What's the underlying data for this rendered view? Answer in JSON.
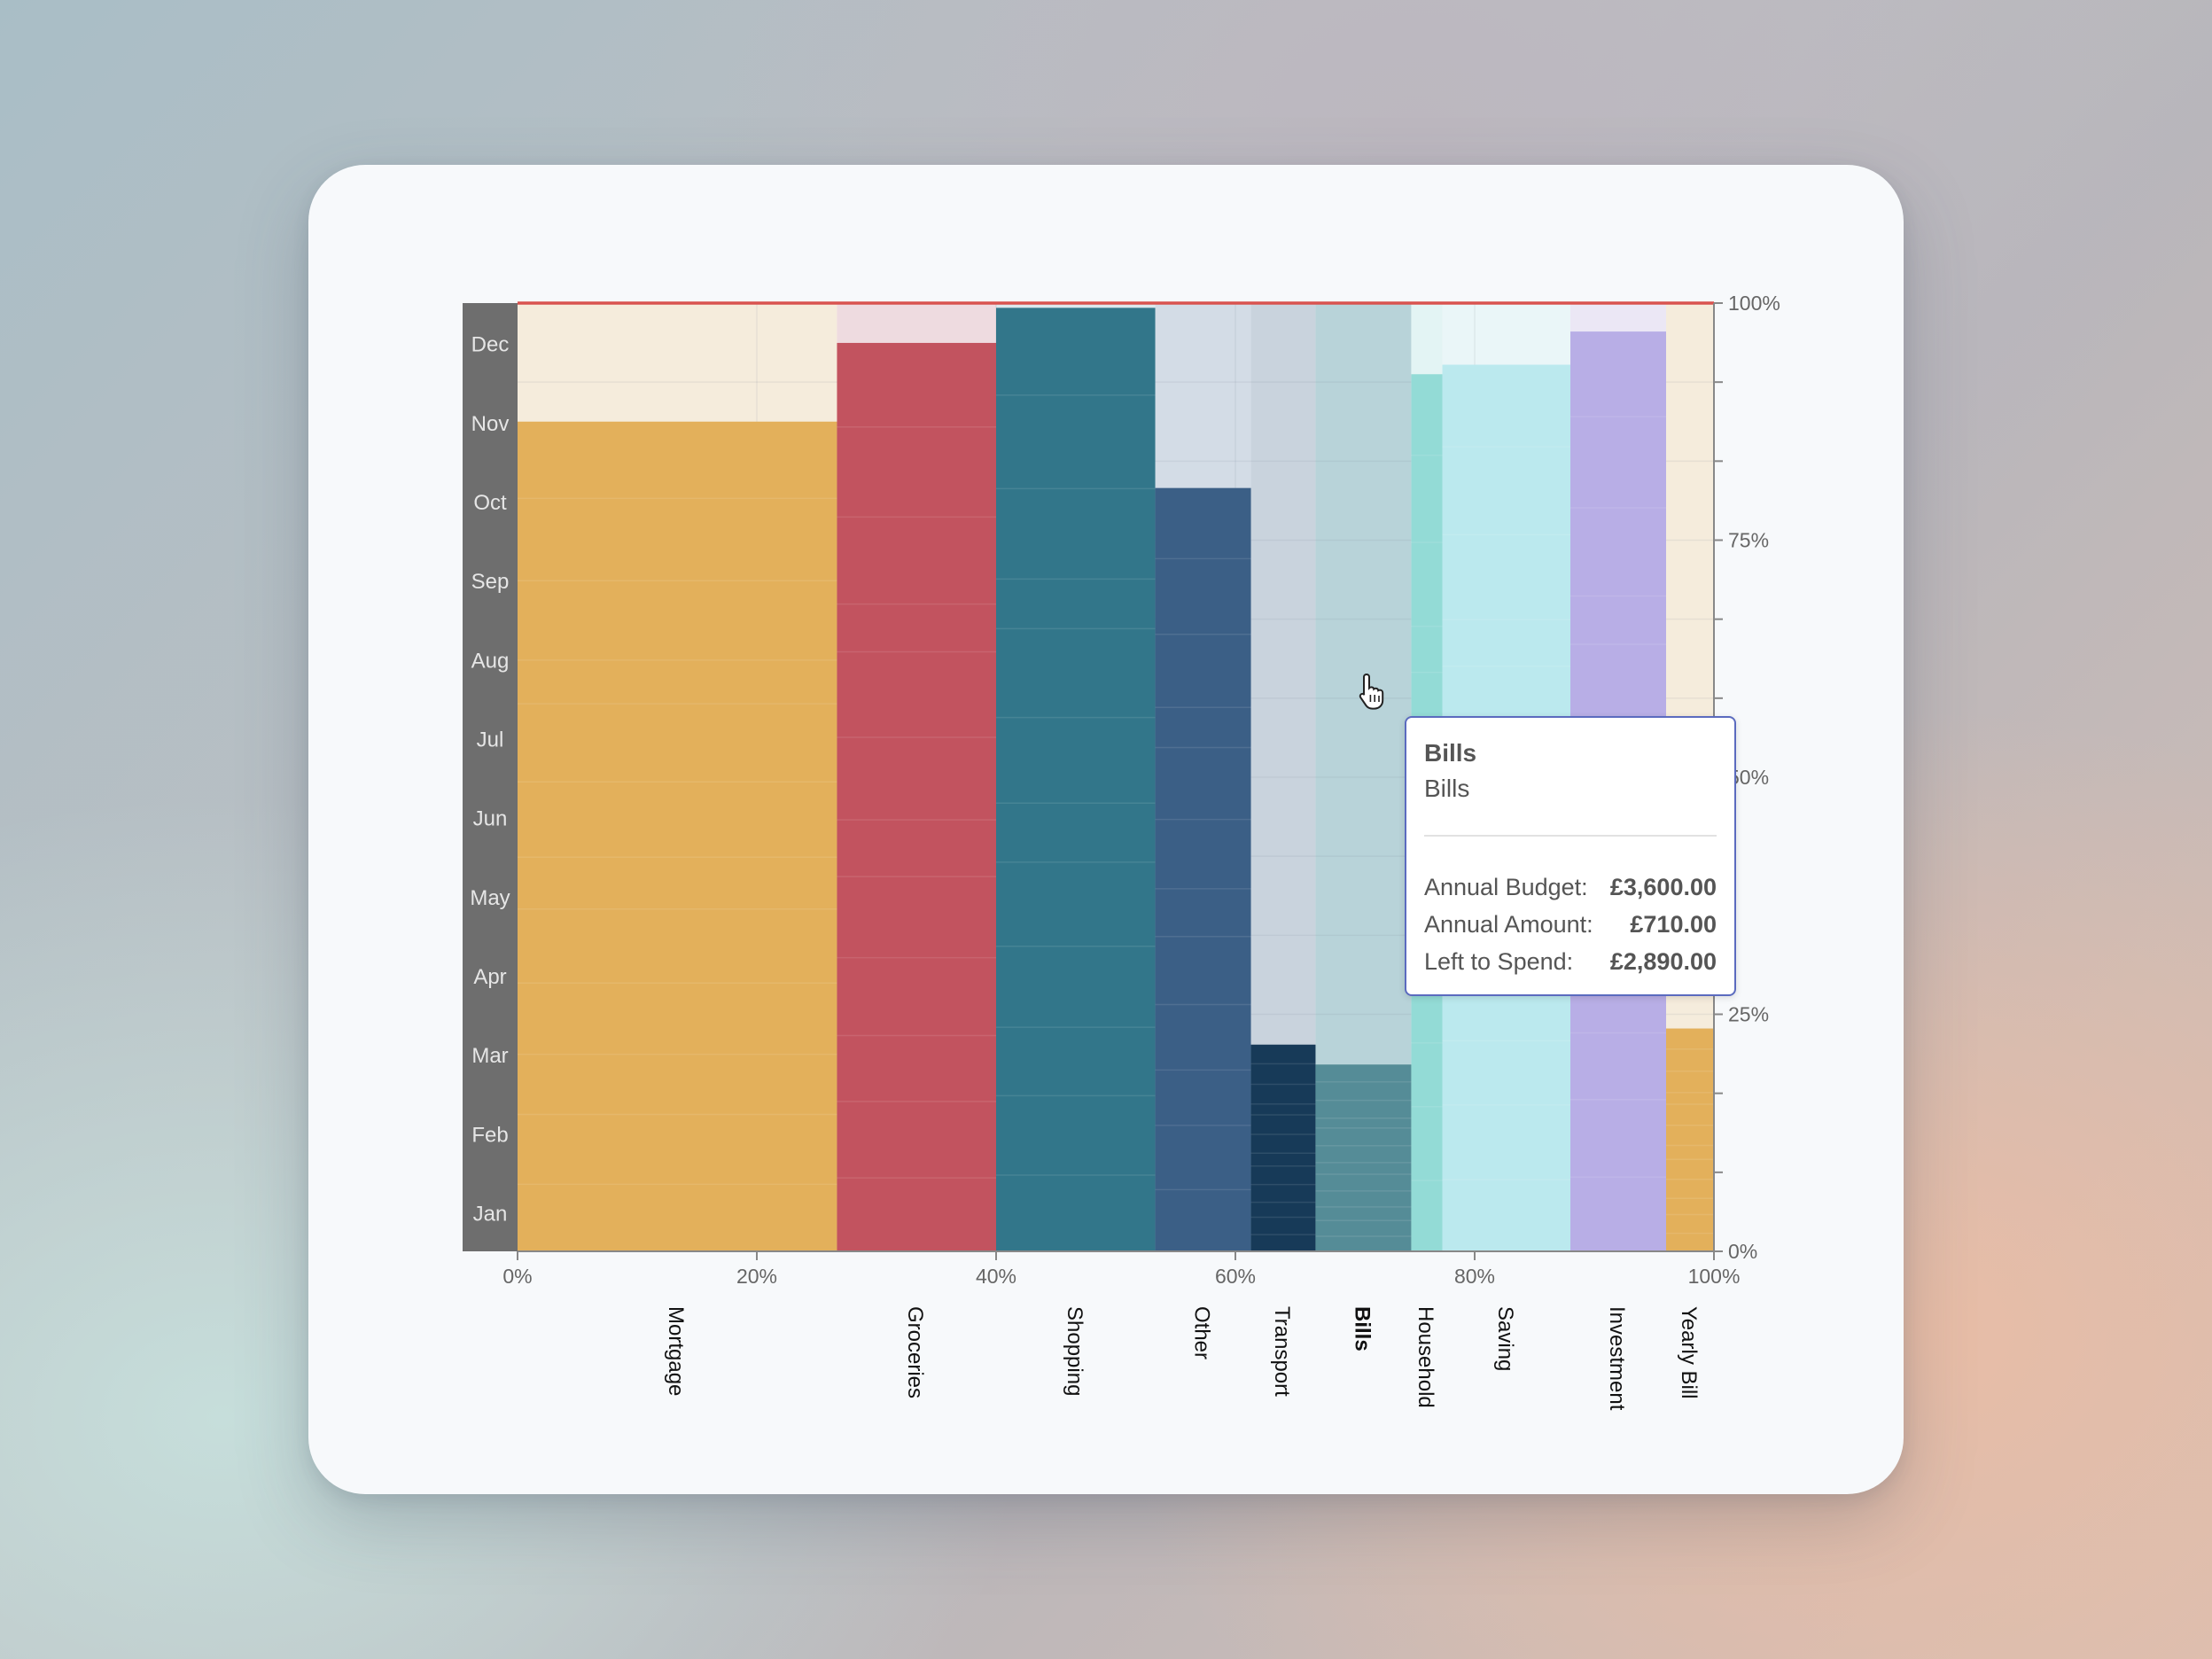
{
  "chart_data": {
    "type": "bar",
    "variant": "variable-width stacked (Marimekko) budget chart",
    "months": [
      "Jan",
      "Feb",
      "Mar",
      "Apr",
      "May",
      "Jun",
      "Jul",
      "Aug",
      "Sep",
      "Oct",
      "Nov",
      "Dec"
    ],
    "x_ticks": [
      "0%",
      "20%",
      "40%",
      "60%",
      "80%",
      "100%"
    ],
    "y_ticks": [
      "0%",
      "25%",
      "50%",
      "75%",
      "100%"
    ],
    "xlim": [
      0,
      100
    ],
    "ylim": [
      0,
      100
    ],
    "target_line": 100,
    "target_line_color": "#d9534f",
    "highlighted": "Bills",
    "categories": [
      {
        "name": "Mortgage",
        "x_start": 0.0,
        "x_end": 26.7,
        "spent_pct": 87.5,
        "color": "#e3b05b",
        "bg": "#f5ecdc"
      },
      {
        "name": "Groceries",
        "x_start": 26.7,
        "x_end": 40.0,
        "spent_pct": 95.8,
        "color": "#c2535f",
        "bg": "#eedbe0"
      },
      {
        "name": "Shopping",
        "x_start": 40.0,
        "x_end": 53.3,
        "spent_pct": 99.5,
        "color": "#32768a",
        "bg": "#dde8ec"
      },
      {
        "name": "Other",
        "x_start": 53.3,
        "x_end": 61.3,
        "spent_pct": 80.5,
        "color": "#3b5f86",
        "bg": "#d3dce6"
      },
      {
        "name": "Transport",
        "x_start": 61.3,
        "x_end": 66.7,
        "spent_pct": 21.8,
        "color": "#173a58",
        "bg": "#c9d3dd"
      },
      {
        "name": "Bills",
        "x_start": 66.7,
        "x_end": 74.7,
        "spent_pct": 19.7,
        "color": "#558c97",
        "bg": "#b8d3d9"
      },
      {
        "name": "Household",
        "x_start": 74.7,
        "x_end": 77.3,
        "spent_pct": 92.5,
        "color": "#93dbd6",
        "bg": "#e3f4f4"
      },
      {
        "name": "Saving",
        "x_start": 77.3,
        "x_end": 88.0,
        "spent_pct": 93.5,
        "color": "#bbe9ee",
        "bg": "#eaf6f8"
      },
      {
        "name": "Investment",
        "x_start": 88.0,
        "x_end": 96.0,
        "spent_pct": 97.0,
        "color": "#b8aee6",
        "bg": "#ebe7f5"
      },
      {
        "name": "Yearly Bill",
        "x_start": 96.0,
        "x_end": 100.0,
        "spent_pct": 23.5,
        "color": "#e3b05b",
        "bg": "#f5ecdc"
      }
    ]
  },
  "tooltip": {
    "title": "Bills",
    "subtitle": "Bills",
    "rows": [
      {
        "label": "Annual Budget:",
        "value": "£3,600.00"
      },
      {
        "label": "Annual Amount:",
        "value": "£710.00"
      },
      {
        "label": "Left to Spend:",
        "value": "£2,890.00"
      }
    ]
  },
  "cursor_icon": "hand-pointer-icon"
}
